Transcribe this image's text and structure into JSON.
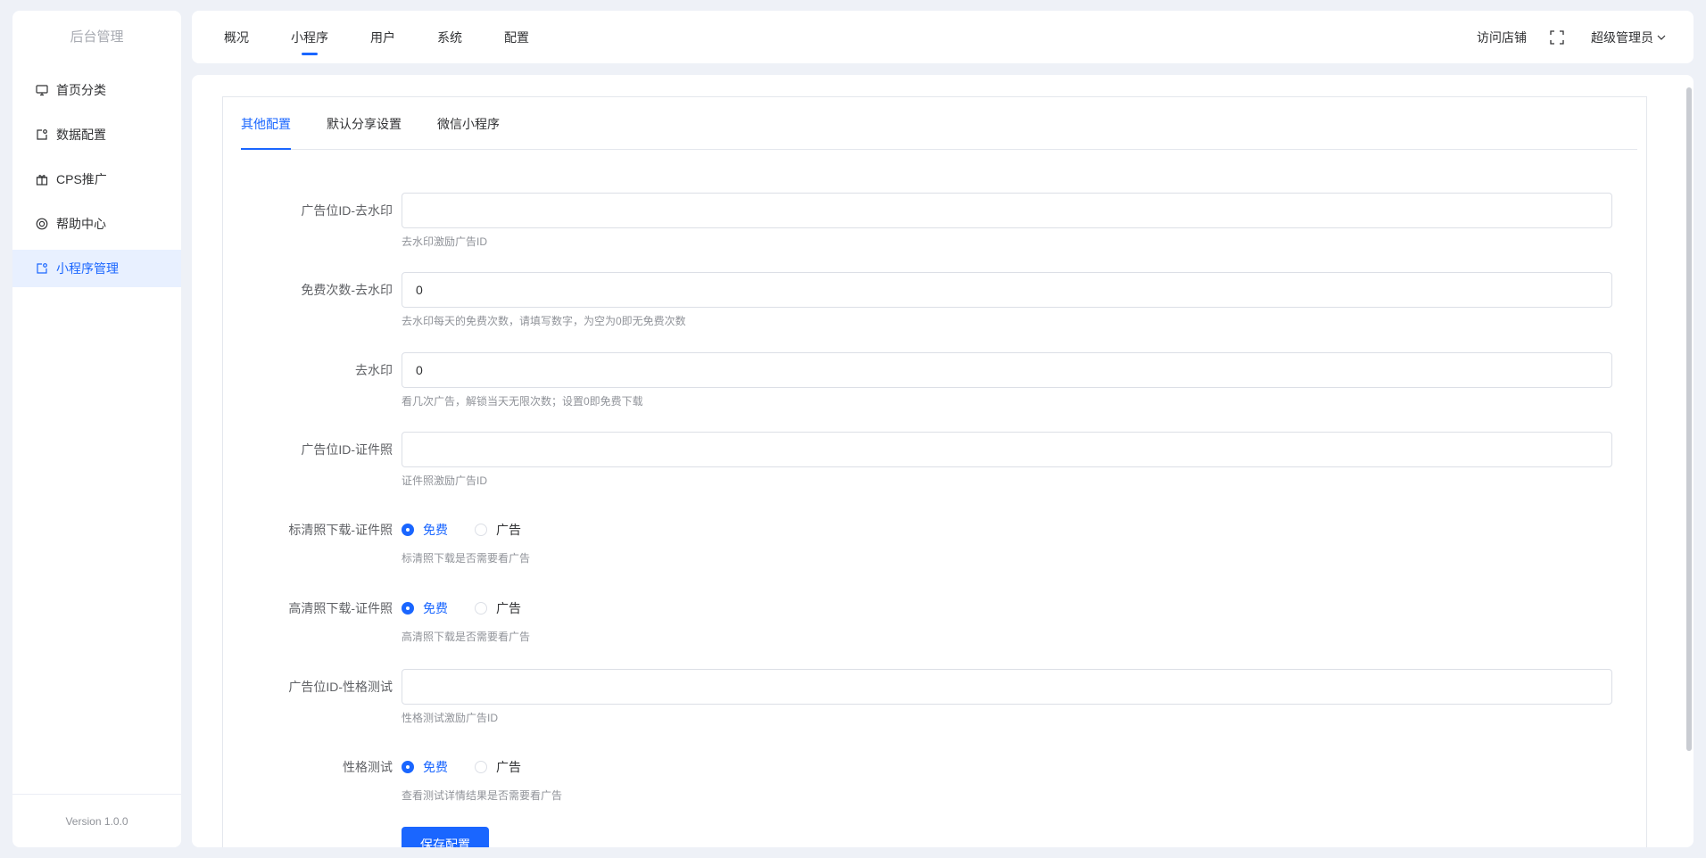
{
  "sidebar": {
    "brand": "后台管理",
    "items": [
      {
        "label": "首页分类",
        "icon": "monitor-icon"
      },
      {
        "label": "数据配置",
        "icon": "edit-icon"
      },
      {
        "label": "CPS推广",
        "icon": "gift-icon"
      },
      {
        "label": "帮助中心",
        "icon": "lifebuoy-icon"
      },
      {
        "label": "小程序管理",
        "icon": "edit-icon",
        "active": true
      }
    ],
    "version": "Version 1.0.0"
  },
  "header": {
    "tabs": [
      "概况",
      "小程序",
      "用户",
      "系统",
      "配置"
    ],
    "active_tab": "小程序",
    "visit_store": "访问店铺",
    "admin": "超级管理员"
  },
  "content": {
    "sub_tabs": [
      "其他配置",
      "默认分享设置",
      "微信小程序"
    ],
    "active_sub_tab": "其他配置",
    "fields": [
      {
        "label": "广告位ID-去水印",
        "type": "input",
        "value": "",
        "help": "去水印激励广告ID"
      },
      {
        "label": "免费次数-去水印",
        "type": "input",
        "value": "0",
        "help": "去水印每天的免费次数，请填写数字，为空为0即无免费次数"
      },
      {
        "label": "去水印",
        "type": "input",
        "value": "0",
        "help": "看几次广告，解锁当天无限次数；设置0即免费下载"
      },
      {
        "label": "广告位ID-证件照",
        "type": "input",
        "value": "",
        "help": "证件照激励广告ID"
      },
      {
        "label": "标清照下载-证件照",
        "type": "radio",
        "options": [
          "免费",
          "广告"
        ],
        "selected": "免费",
        "help": "标清照下载是否需要看广告"
      },
      {
        "label": "高清照下载-证件照",
        "type": "radio",
        "options": [
          "免费",
          "广告"
        ],
        "selected": "免费",
        "help": "高清照下载是否需要看广告"
      },
      {
        "label": "广告位ID-性格测试",
        "type": "input",
        "value": "",
        "help": "性格测试激励广告ID"
      },
      {
        "label": "性格测试",
        "type": "radio",
        "options": [
          "免费",
          "广告"
        ],
        "selected": "免费",
        "help": "查看测试详情结果是否需要看广告"
      }
    ],
    "save_label": "保存配置"
  },
  "colors": {
    "accent": "#1a66ff",
    "background": "#eef1f7"
  }
}
